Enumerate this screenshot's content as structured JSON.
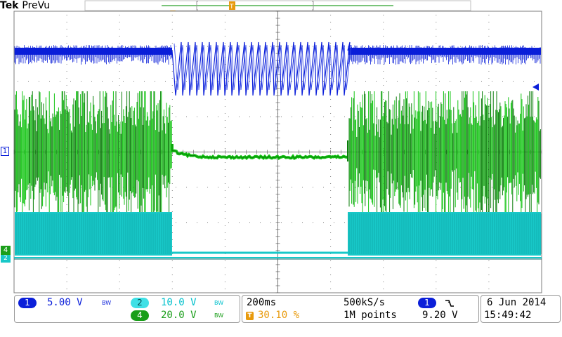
{
  "header": {
    "brand": "Tek",
    "mode": "PreVu",
    "trigger_marker": "T"
  },
  "channels": {
    "ch1": {
      "number": "1",
      "scale": "5.00 V",
      "bw": "BW",
      "color": "#0b1fd9"
    },
    "ch2": {
      "number": "2",
      "scale": "10.0 V",
      "bw": "BW",
      "color": "#00c8d2"
    },
    "ch4": {
      "number": "4",
      "scale": "20.0 V",
      "bw": "BW",
      "color": "#1a9e1a"
    }
  },
  "timebase": {
    "scale": "200ms",
    "sample_rate": "500kS/s",
    "trigger_position": "30.10 %",
    "record_length": "1M points"
  },
  "trigger": {
    "source": "1",
    "slope_icon": "falling-edge-icon",
    "level": "9.20 V"
  },
  "datetime": {
    "date": "6 Jun 2014",
    "time": "15:49:42"
  },
  "left_markers": {
    "ch1": "1",
    "ch4": "4",
    "ch2": "2"
  },
  "colors": {
    "ch1_trace": "#0b1fd9",
    "ch4_trace": "#13c413",
    "ch4_dark": "#0a7e0a",
    "ch2_trace": "#18c8c8",
    "grid": "#7d7d7d",
    "trigger_orange": "#e89a0c"
  }
}
